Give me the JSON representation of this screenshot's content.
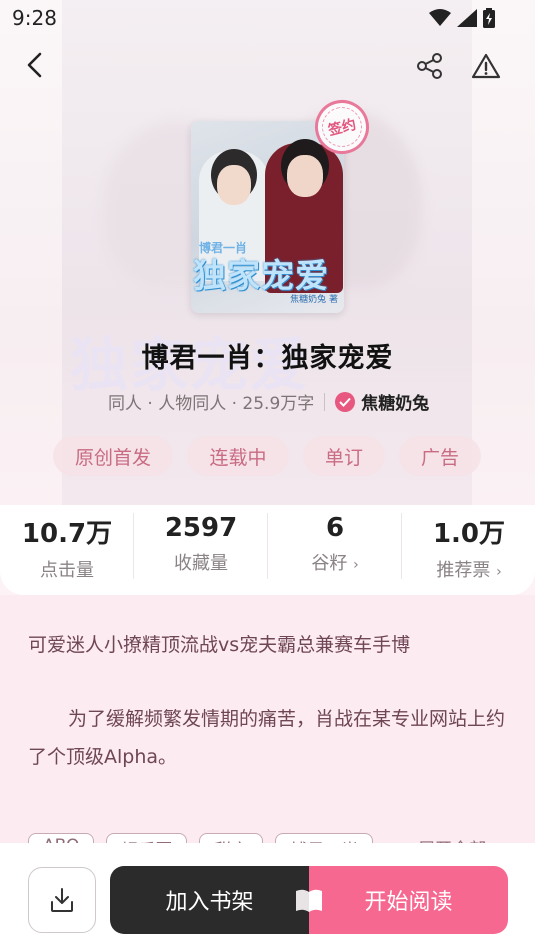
{
  "status_bar": {
    "time": "9:28"
  },
  "header": {
    "back_icon": "chevron-left-icon",
    "share_icon": "share-icon",
    "report_icon": "warning-triangle-icon"
  },
  "cover": {
    "series_label": "博君一肖",
    "title_art": "独家宠爱",
    "author_art": "焦糖奶兔 著",
    "stamp": "签约"
  },
  "book": {
    "title": "博君一肖：独家宠爱",
    "meta": "同人 · 人物同人 · 25.9万字",
    "author": "焦糖奶兔"
  },
  "tags": [
    "原创首发",
    "连载中",
    "单订",
    "广告"
  ],
  "stats": [
    {
      "value": "10.7万",
      "label": "点击量",
      "has_chevron": false
    },
    {
      "value": "2597",
      "label": "收藏量",
      "has_chevron": false
    },
    {
      "value": "6",
      "label": "谷籽",
      "has_chevron": true
    },
    {
      "value": "1.0万",
      "label": "推荐票",
      "has_chevron": true
    }
  ],
  "intro": {
    "tagline": "可爱迷人小撩精顶流战vs宠夫霸总兼赛车手博",
    "paragraph": "为了缓解频繁发情期的痛苦，肖战在某专业网站上约了个顶级Alpha。",
    "keyword_tags": [
      "ABO",
      "娱乐圈",
      "甜文",
      "博君一肖"
    ],
    "expand_label": "展开全部"
  },
  "bottom_bar": {
    "download_icon": "download-icon",
    "add_shelf_label": "加入书架",
    "start_reading_label": "开始阅读"
  },
  "colors": {
    "accent": "#f76891",
    "dark_button": "#2b2b2b",
    "tag_text": "#c96b83",
    "intro_bg": "#fcebf0"
  }
}
